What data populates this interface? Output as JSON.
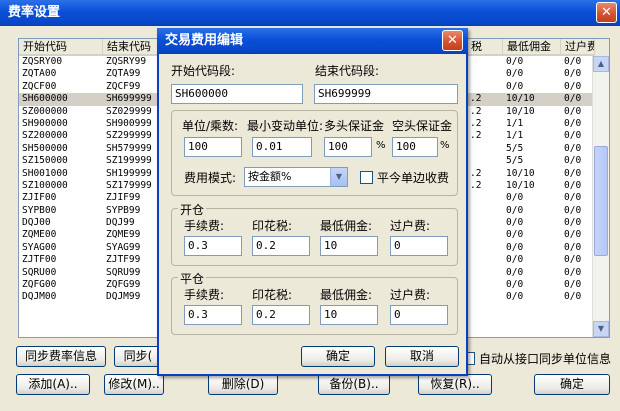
{
  "outer": {
    "title": "费率设置",
    "columns": [
      "开始代码",
      "结束代码",
      "税",
      "最低佣金",
      "过户费"
    ],
    "rows": [
      {
        "start": "ZQSRY00",
        "end": "ZQSRY99",
        "tax": "",
        "min": "0/0",
        "fee": "0/0"
      },
      {
        "start": "ZQTA00",
        "end": "ZQTA99",
        "tax": "",
        "min": "0/0",
        "fee": "0/0"
      },
      {
        "start": "ZQCF00",
        "end": "ZQCF99",
        "tax": "",
        "min": "0/0",
        "fee": "0/0"
      },
      {
        "start": "SH600000",
        "end": "SH699999",
        "tax": ".2",
        "min": "10/10",
        "fee": "0/0"
      },
      {
        "start": "SZ000000",
        "end": "SZ029999",
        "tax": ".2",
        "min": "10/10",
        "fee": "0/0"
      },
      {
        "start": "SH900000",
        "end": "SH900999",
        "tax": ".2",
        "min": "1/1",
        "fee": "0/0"
      },
      {
        "start": "SZ200000",
        "end": "SZ299999",
        "tax": ".2",
        "min": "1/1",
        "fee": "0/0"
      },
      {
        "start": "SH500000",
        "end": "SH579999",
        "tax": "",
        "min": "5/5",
        "fee": "0/0"
      },
      {
        "start": "SZ150000",
        "end": "SZ199999",
        "tax": "",
        "min": "5/5",
        "fee": "0/0"
      },
      {
        "start": "SH001000",
        "end": "SH199999",
        "tax": ".2",
        "min": "10/10",
        "fee": "0/0"
      },
      {
        "start": "SZ100000",
        "end": "SZ179999",
        "tax": ".2",
        "min": "10/10",
        "fee": "0/0"
      },
      {
        "start": "ZJIF00",
        "end": "ZJIF99",
        "tax": "",
        "min": "0/0",
        "fee": "0/0"
      },
      {
        "start": "SYPB00",
        "end": "SYPB99",
        "tax": "",
        "min": "0/0",
        "fee": "0/0"
      },
      {
        "start": "DQJ00",
        "end": "DQJ99",
        "tax": "",
        "min": "0/0",
        "fee": "0/0"
      },
      {
        "start": "ZQME00",
        "end": "ZQME99",
        "tax": "",
        "min": "0/0",
        "fee": "0/0"
      },
      {
        "start": "SYAG00",
        "end": "SYAG99",
        "tax": "",
        "min": "0/0",
        "fee": "0/0"
      },
      {
        "start": "ZJTF00",
        "end": "ZJTF99",
        "tax": "",
        "min": "0/0",
        "fee": "0/0"
      },
      {
        "start": "SQRU00",
        "end": "SQRU99",
        "tax": "",
        "min": "0/0",
        "fee": "0/0"
      },
      {
        "start": "ZQFG00",
        "end": "ZQFG99",
        "tax": "",
        "min": "0/0",
        "fee": "0/0"
      },
      {
        "start": "DQJM00",
        "end": "DQJM99",
        "tax": "",
        "min": "0/0",
        "fee": "0/0"
      }
    ],
    "btn_sync_info": "同步费率信息",
    "btn_sync2": "同步(",
    "auto_sync_label": "自动从接口同步单位信息",
    "btn_add": "添加(A)..",
    "btn_edit": "修改(M)..",
    "btn_delete": "删除(D)",
    "btn_backup": "备份(B)..",
    "btn_restore": "恢复(R)..",
    "btn_ok": "确定",
    "close_glyph": "✕"
  },
  "dialog": {
    "title": "交易费用编辑",
    "start_code_label": "开始代码段:",
    "end_code_label": "结束代码段:",
    "start_code": "SH600000",
    "end_code": "SH699999",
    "unit_label": "单位/乘数:",
    "min_change_label": "最小变动单位:",
    "long_margin_label": "多头保证金",
    "short_margin_label": "空头保证金",
    "unit_value": "100",
    "min_change_value": "0.01",
    "long_margin_value": "100",
    "short_margin_value": "100",
    "percent": "%",
    "fee_mode_label": "费用模式:",
    "fee_mode_value": "按金额%",
    "close_today_label": "平今单边收费",
    "open_group": "开仓",
    "close_group": "平仓",
    "commission_label": "手续费:",
    "stamp_tax_label": "印花税:",
    "min_commission_label": "最低佣金:",
    "transfer_fee_label": "过户费:",
    "open_commission": "0.3",
    "open_stamp_tax": "0.2",
    "open_min_commission": "10",
    "open_transfer_fee": "0",
    "close_commission": "0.3",
    "close_stamp_tax": "0.2",
    "close_min_commission": "10",
    "close_transfer_fee": "0",
    "ok": "确定",
    "cancel": "取消",
    "close_glyph": "✕",
    "dropdown_glyph": "▼"
  }
}
